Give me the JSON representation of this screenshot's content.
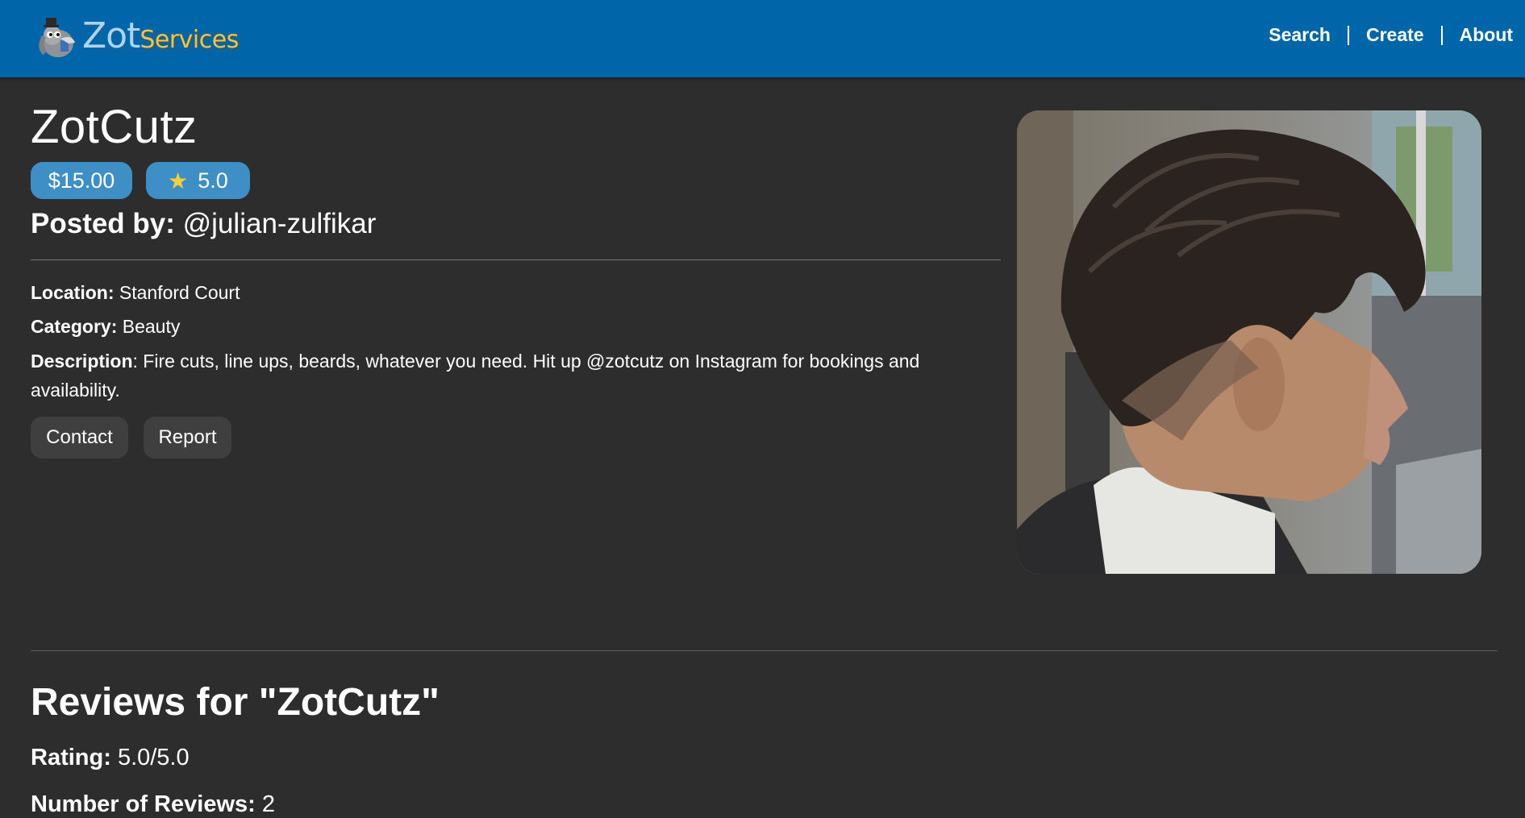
{
  "brand": {
    "zot": "Zot",
    "services": "Services"
  },
  "nav": {
    "links": [
      "Search",
      "Create",
      "About"
    ]
  },
  "service": {
    "title": "ZotCutz",
    "price": "$15.00",
    "rating": "5.0",
    "posted_label": "Posted by:",
    "posted_by": "@julian-zulfikar",
    "location_label": "Location:",
    "location": "Stanford Court",
    "category_label": "Category:",
    "category": "Beauty",
    "description_label": "Description",
    "description": ": Fire cuts, line ups, beards, whatever you need. Hit up @zotcutz on Instagram for bookings and availability."
  },
  "actions": {
    "contact": "Contact",
    "report": "Report"
  },
  "reviews": {
    "title": "Reviews for \"ZotCutz\"",
    "rating_label": "Rating:",
    "rating_value": "5.0/5.0",
    "count_label": "Number of Reviews:",
    "count_value": "2"
  },
  "colors": {
    "navbar": "#0066aa",
    "background": "#2d2d2d",
    "pill": "#3d8fc6",
    "star": "#f7d038",
    "button": "#3f3f3f"
  },
  "icons": {
    "rating_pill": "star-icon",
    "logo": "anteater-mascot-icon"
  }
}
